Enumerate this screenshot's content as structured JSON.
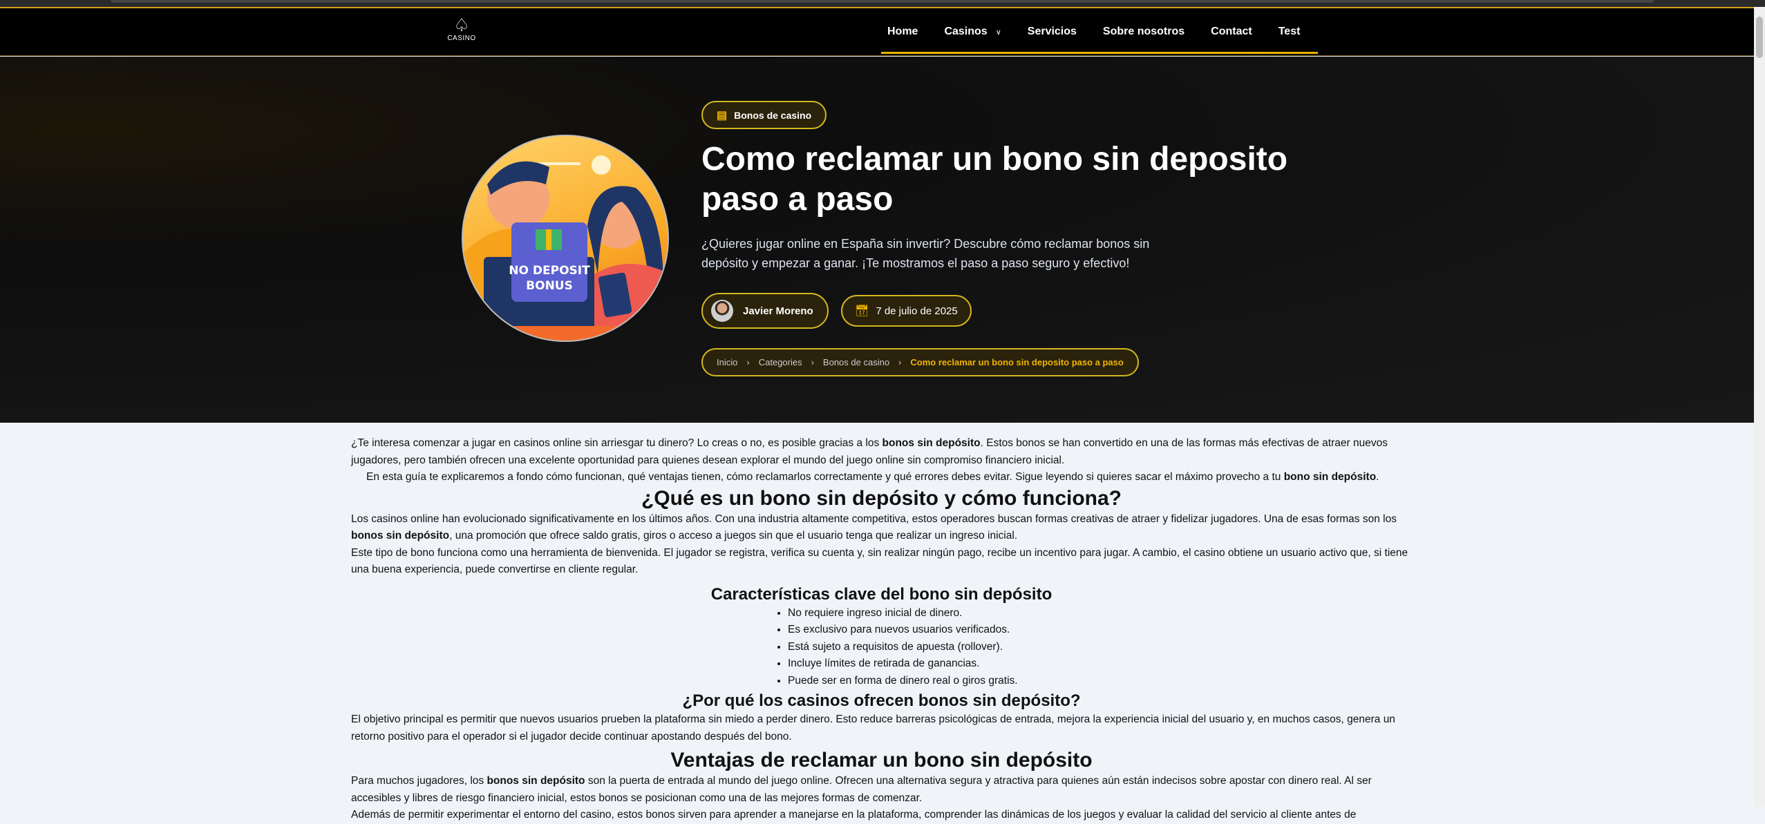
{
  "nav": {
    "logo_text": "CASINO",
    "items": [
      "Home",
      "Casinos",
      "Servicios",
      "Sobre nosotros",
      "Contact",
      "Test"
    ]
  },
  "hero": {
    "category": "Bonos de casino",
    "title": "Como reclamar un bono sin deposito paso a paso",
    "subtitle": "¿Quieres jugar online en España sin invertir? Descubre cómo reclamar bonos sin depósito y empezar a ganar. ¡Te mostramos el paso a paso seguro y efectivo!",
    "author": "Javier Moreno",
    "date": "7 de julio de 2025",
    "image_text": "NO DEPOSIT BONUS",
    "breadcrumb": [
      "Inicio",
      "Categories",
      "Bonos de casino",
      "Como reclamar un bono sin deposito paso a paso"
    ]
  },
  "article": {
    "p1": [
      "¿Te interesa comenzar a jugar en casinos online sin arriesgar tu dinero? Lo creas o no, es posible gracias a los ",
      "bonos sin depósito",
      ". Estos bonos se han convertido en una de las formas más efectivas de atraer nuevos jugadores, pero también ofrecen una excelente oportunidad para quienes desean explorar el mundo del juego online sin compromiso financiero inicial."
    ],
    "p2": [
      "En esta guía te explicaremos a fondo cómo funcionan, qué ventajas tienen, cómo reclamarlos correctamente y qué errores debes evitar. Sigue leyendo si quieres sacar el máximo provecho a tu ",
      "bono sin depósito",
      "."
    ],
    "h2_1": "¿Qué es un bono sin depósito y cómo funciona?",
    "p3": [
      "Los casinos online han evolucionado significativamente en los últimos años. Con una industria altamente competitiva, estos operadores buscan formas creativas de atraer y fidelizar jugadores. Una de esas formas son los ",
      "bonos sin depósito",
      ", una promoción que ofrece saldo gratis, giros o acceso a juegos sin que el usuario tenga que realizar un ingreso inicial."
    ],
    "p4": "Este tipo de bono funciona como una herramienta de bienvenida. El jugador se registra, verifica su cuenta y, sin realizar ningún pago, recibe un incentivo para jugar. A cambio, el casino obtiene un usuario activo que, si tiene una buena experiencia, puede convertirse en cliente regular.",
    "h3_1": "Características clave del bono sin depósito",
    "list": [
      "No requiere ingreso inicial de dinero.",
      "Es exclusivo para nuevos usuarios verificados.",
      "Está sujeto a requisitos de apuesta (rollover).",
      "Incluye límites de retirada de ganancias.",
      "Puede ser en forma de dinero real o giros gratis."
    ],
    "h3_2": "¿Por qué los casinos ofrecen bonos sin depósito?",
    "p5": "El objetivo principal es permitir que nuevos usuarios prueben la plataforma sin miedo a perder dinero. Esto reduce barreras psicológicas de entrada, mejora la experiencia inicial del usuario y, en muchos casos, genera un retorno positivo para el operador si el jugador decide continuar apostando después del bono.",
    "h2_2": "Ventajas de reclamar un bono sin depósito",
    "p6": [
      "Para muchos jugadores, los ",
      "bonos sin depósito",
      " son la puerta de entrada al mundo del juego online. Ofrecen una alternativa segura y atractiva para quienes aún están indecisos sobre apostar con dinero real. Al ser accesibles y libres de riesgo financiero inicial, estos bonos se posicionan como una de las mejores formas de comenzar."
    ],
    "p7": "Además de permitir experimentar el entorno del casino, estos bonos sirven para aprender a manejarse en la plataforma, comprender las dinámicas de los juegos y evaluar la calidad del servicio al cliente antes de"
  },
  "colors": {
    "accent": "#e6b400",
    "nav_bg": "#000000",
    "hero_bg": "#141414",
    "content_bg": "#f0f3f8"
  }
}
